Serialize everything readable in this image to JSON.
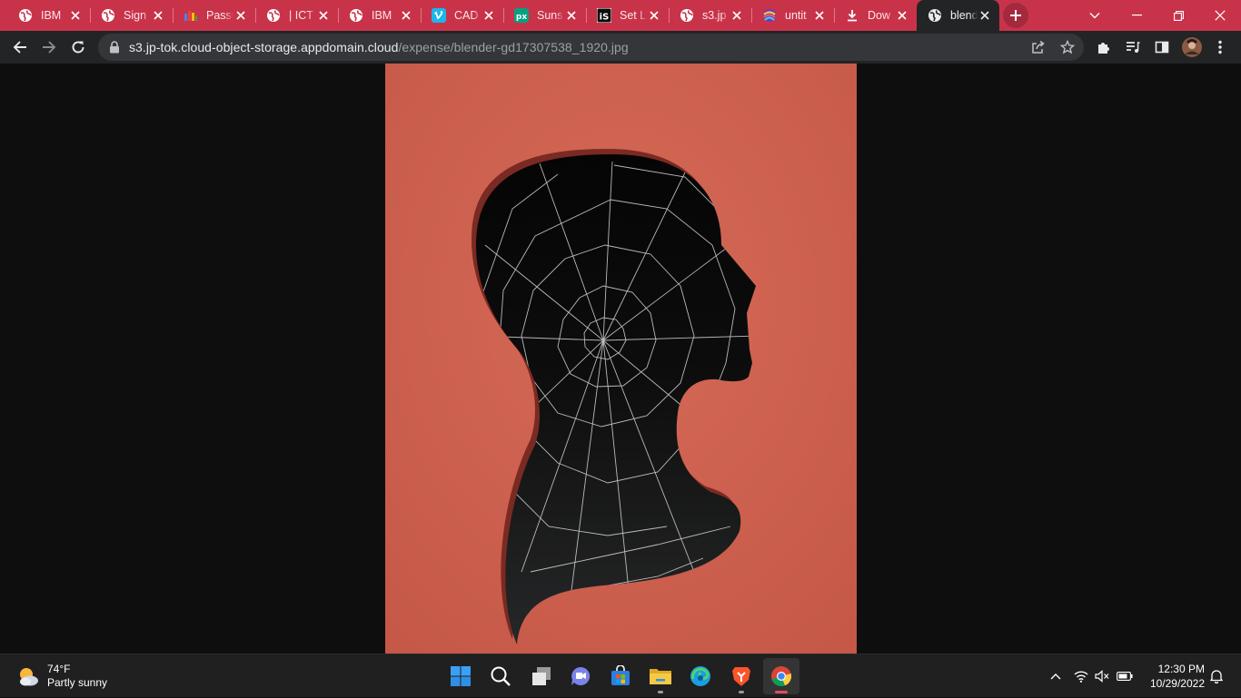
{
  "browser": {
    "tabs": [
      {
        "title": "IBM",
        "icon": "globe-icon",
        "active": false
      },
      {
        "title": "Sign",
        "icon": "globe-icon",
        "active": false
      },
      {
        "title": "Passw",
        "icon": "password-manager-icon",
        "active": false
      },
      {
        "title": "| ICT",
        "icon": "globe-icon",
        "active": false
      },
      {
        "title": "IBM",
        "icon": "globe-icon",
        "active": false
      },
      {
        "title": "CAD",
        "icon": "vimeo-icon",
        "active": false
      },
      {
        "title": "Suns",
        "icon": "pexels-icon",
        "active": false
      },
      {
        "title": "Set L",
        "icon": "istock-icon",
        "active": false
      },
      {
        "title": "s3.jp",
        "icon": "globe-icon",
        "active": false
      },
      {
        "title": "untit",
        "icon": "colorful-logo-icon",
        "active": false
      },
      {
        "title": "Dow",
        "icon": "download-icon",
        "active": false
      },
      {
        "title": "blend",
        "icon": "globe-icon",
        "active": true
      }
    ],
    "omnibox": {
      "host": "s3.jp-tok.cloud-object-storage.appdomain.cloud",
      "path": "/expense/blender-gd17307538_1920.jpg"
    },
    "colors": {
      "tabstrip": "#c8334a",
      "toolbar": "#232425",
      "omnibox": "#35363a"
    }
  },
  "artwork": {
    "colors": {
      "background": "#d0624f",
      "silhouette": "#0c0c0c",
      "web": "#e6e6e6"
    }
  },
  "taskbar": {
    "weather": {
      "temperature": "74°F",
      "condition": "Partly sunny",
      "icon": "partly-sunny-icon"
    },
    "apps": [
      "start-icon",
      "search-icon",
      "task-view-icon",
      "chat-icon",
      "store-icon",
      "file-explorer-icon",
      "edge-icon",
      "brave-icon",
      "chrome-icon"
    ],
    "clock": {
      "time": "12:30 PM",
      "date": "10/29/2022"
    }
  }
}
